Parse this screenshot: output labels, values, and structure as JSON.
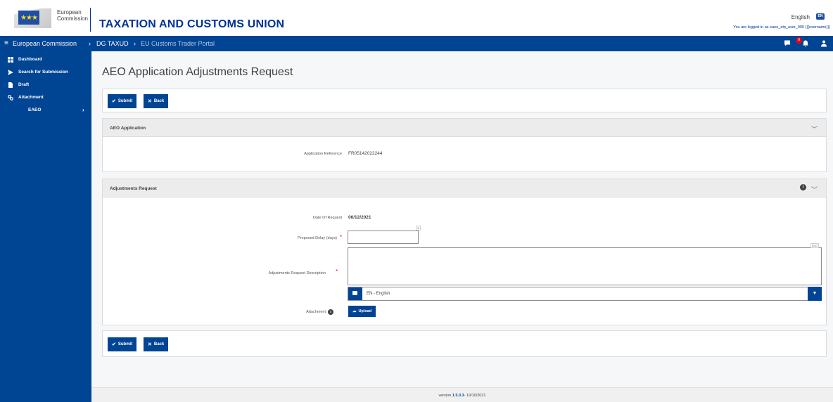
{
  "header": {
    "org_line1": "European",
    "org_line2": "Commission",
    "site_title": "TAXATION AND CUSTOMS UNION",
    "language": "English",
    "language_code": "EN",
    "logged_in": "You are logged-in as eaeo_etp_user_000 ({{username}})"
  },
  "navbar": {
    "breadcrumbs": [
      "European Commission",
      "DG TAXUD",
      "EU Customs Trader Portal"
    ],
    "notification_count": "0",
    "icons": [
      "comment-icon",
      "bell-icon",
      "user-icon"
    ]
  },
  "sidebar": {
    "items": [
      {
        "label": "Dashboard",
        "icon": "dashboard-icon"
      },
      {
        "label": "Search for Submission",
        "icon": "send-icon"
      },
      {
        "label": "Draft",
        "icon": "file-icon"
      },
      {
        "label": "Attachment",
        "icon": "link-icon"
      },
      {
        "label": "EAEO",
        "icon": "chevron-right-icon"
      }
    ]
  },
  "page": {
    "title": "AEO Application Adjustments Request"
  },
  "toolbar": {
    "submit_label": "Submit",
    "back_label": "Back"
  },
  "aeo_application": {
    "title": "AEO Application",
    "reference_label": "Application Reference",
    "reference_value": "FR05142022244"
  },
  "adjustments": {
    "title": "Adjustments Request",
    "date_label": "Date Of Request",
    "date_value": "06/12/2021",
    "delay_label": "Proposed Delay (days)",
    "delay_counter": "3",
    "delay_value": "",
    "description_label": "Adjustments Request Description",
    "description_counter": "500",
    "description_value": "",
    "language_selected": "EN - English",
    "attachment_label": "Attachment",
    "upload_label": "Upload"
  },
  "footer": {
    "version_prefix": "version ",
    "version": "1.5.0.3",
    "version_suffix": "- 19/10/2021"
  },
  "colors": {
    "primary": "#004494",
    "brand": "#003399",
    "required": "#e30613"
  }
}
